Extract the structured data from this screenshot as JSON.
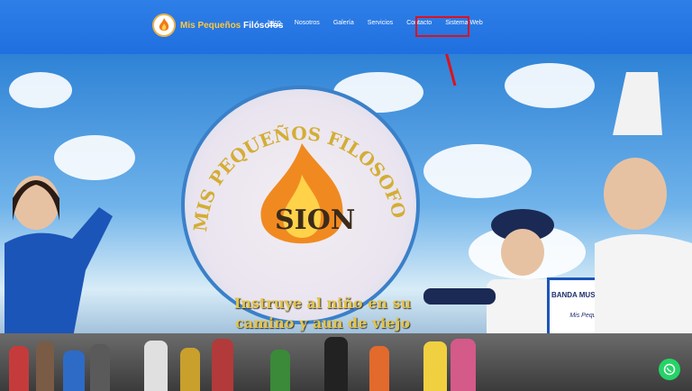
{
  "header": {
    "brand_name_part1": "Mis Pequeños",
    "brand_name_part2": "Filósofos",
    "nav": [
      "Inico",
      "Nosotros",
      "Galería",
      "Servicios",
      "Contacto",
      "Sistema Web"
    ],
    "active_nav": "Inico",
    "highlight_color": "#e0101b"
  },
  "hero": {
    "emblem_arc_text": "MIS PEQUEÑOS FILOSOFOS",
    "emblem_center_text": "SION",
    "motto": "Instruye al niño en su camino y aun de viejo no se apartará de él",
    "band_label": "BANDA MUSICO MARCIAL DE PAZ",
    "band_sub": "Mis Pequeños Filósofos"
  },
  "floating": {
    "whatsapp_icon": "whatsapp-icon"
  }
}
